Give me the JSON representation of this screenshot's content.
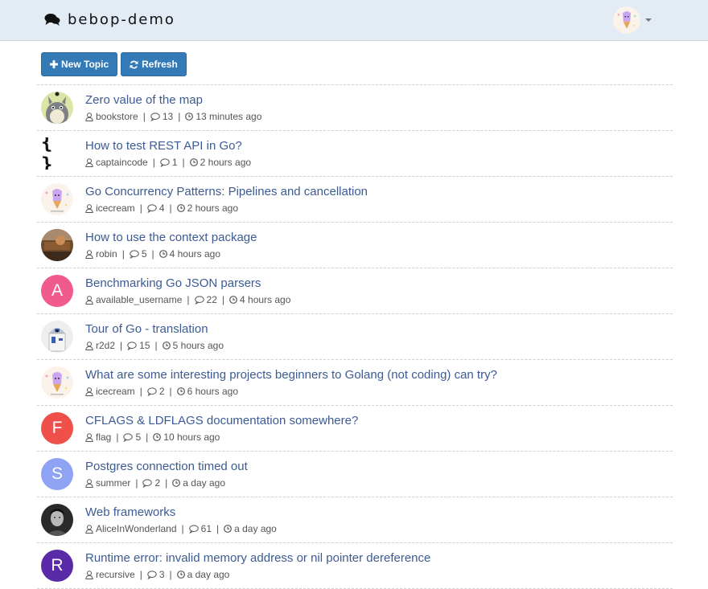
{
  "app": {
    "brand": "bebop-demo",
    "accent": "#337ab7",
    "link_color": "#3c5b94",
    "navbar_bg": "#e3ecf5"
  },
  "toolbar": {
    "new_topic_label": "New Topic",
    "new_topic_icon": "plus-icon",
    "refresh_label": "Refresh",
    "refresh_icon": "refresh-icon"
  },
  "topics": [
    {
      "title": "Zero value of the map",
      "author": "bookstore",
      "comments": "13",
      "time": "13 minutes ago",
      "avatar": {
        "kind": "image",
        "desc": "totoro"
      }
    },
    {
      "title": "How to test REST API in Go?",
      "author": "captaincode",
      "comments": "1",
      "time": "2 hours ago",
      "avatar": {
        "kind": "glyph",
        "glyph": "{ }"
      }
    },
    {
      "title": "Go Concurrency Patterns: Pipelines and cancellation",
      "author": "icecream",
      "comments": "4",
      "time": "2 hours ago",
      "avatar": {
        "kind": "image",
        "desc": "icecream"
      }
    },
    {
      "title": "How to use the context package",
      "author": "robin",
      "comments": "5",
      "time": "4 hours ago",
      "avatar": {
        "kind": "image",
        "desc": "photo"
      }
    },
    {
      "title": "Benchmarking Go JSON parsers",
      "author": "available_username",
      "comments": "22",
      "time": "4 hours ago",
      "avatar": {
        "kind": "letter",
        "letter": "A",
        "color": "#f05a8c"
      }
    },
    {
      "title": "Tour of Go - translation",
      "author": "r2d2",
      "comments": "15",
      "time": "5 hours ago",
      "avatar": {
        "kind": "image",
        "desc": "r2d2"
      }
    },
    {
      "title": "What are some interesting projects beginners to Golang (not coding) can try?",
      "author": "icecream",
      "comments": "2",
      "time": "6 hours ago",
      "avatar": {
        "kind": "image",
        "desc": "icecream"
      }
    },
    {
      "title": "CFLAGS & LDFLAGS documentation somewhere?",
      "author": "flag",
      "comments": "5",
      "time": "10 hours ago",
      "avatar": {
        "kind": "letter",
        "letter": "F",
        "color": "#f0504a"
      }
    },
    {
      "title": "Postgres connection timed out",
      "author": "summer",
      "comments": "2",
      "time": "a day ago",
      "avatar": {
        "kind": "letter",
        "letter": "S",
        "color": "#8fa3f5"
      }
    },
    {
      "title": "Web frameworks",
      "author": "AliceInWonderland",
      "comments": "61",
      "time": "a day ago",
      "avatar": {
        "kind": "image",
        "desc": "bw-photo"
      }
    },
    {
      "title": "Runtime error: invalid memory address or nil pointer dereference",
      "author": "recursive",
      "comments": "3",
      "time": "a day ago",
      "avatar": {
        "kind": "letter",
        "letter": "R",
        "color": "#5b2aa8"
      }
    }
  ]
}
